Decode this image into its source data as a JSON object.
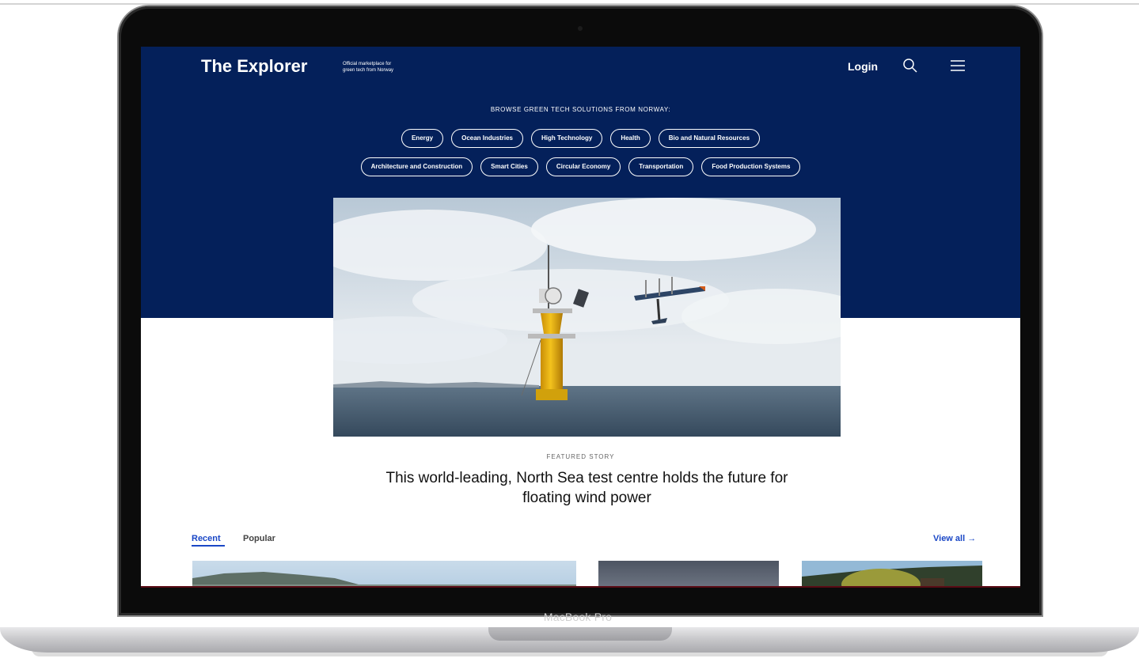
{
  "device": {
    "label": "MacBook Pro"
  },
  "header": {
    "logo": "The Explorer",
    "tagline_line1": "Official marketplace for",
    "tagline_line2": "green tech from Norway",
    "login": "Login",
    "search_icon": "search-icon",
    "menu_icon": "hamburger-menu-icon"
  },
  "browse": {
    "title": "BROWSE GREEN TECH SOLUTIONS FROM NORWAY:",
    "tags_row1": [
      "Energy",
      "Ocean Industries",
      "High Technology",
      "Health",
      "Bio and Natural Resources"
    ],
    "tags_row2": [
      "Architecture and Construction",
      "Smart Cities",
      "Circular Economy",
      "Transportation",
      "Food Production Systems"
    ]
  },
  "featured": {
    "label": "FEATURED STORY",
    "title": "This world-leading, North Sea test centre holds the future for floating wind power"
  },
  "tabs": {
    "recent": "Recent",
    "popular": "Popular",
    "active": "Recent",
    "view_all": "View all →"
  },
  "colors": {
    "hero_background": "#04205a",
    "accent_link": "#1a47c6"
  }
}
